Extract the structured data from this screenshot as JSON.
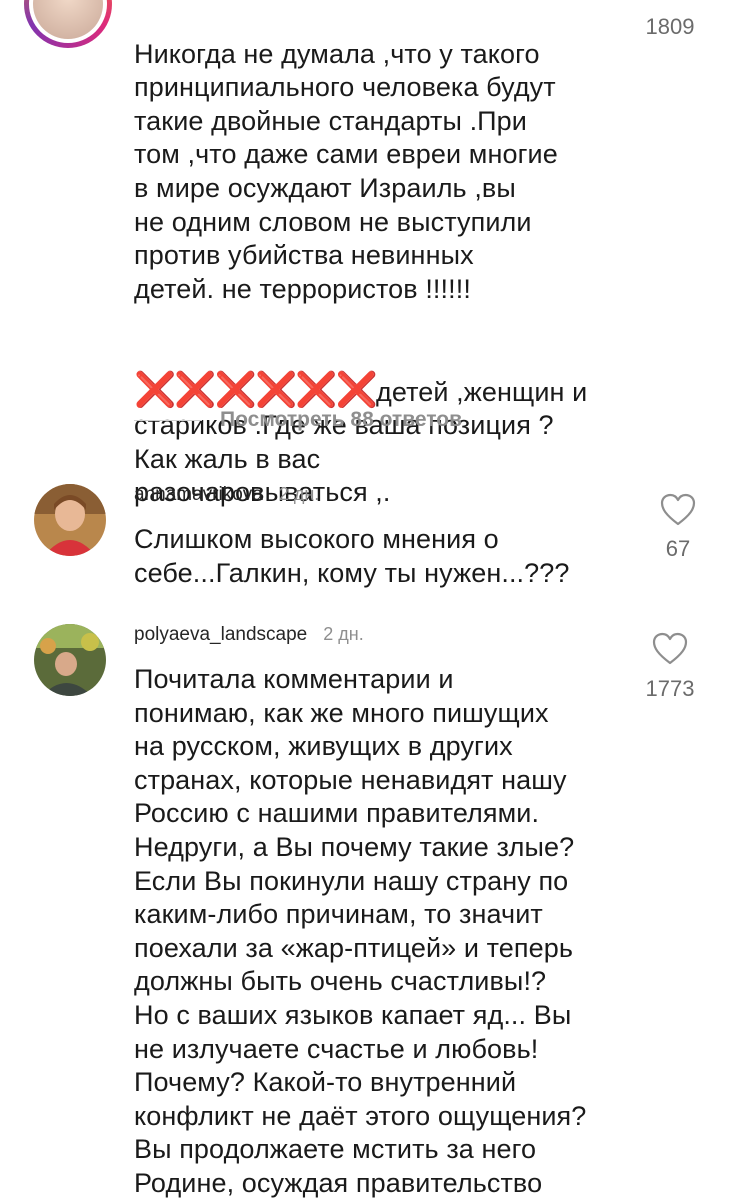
{
  "comments": [
    {
      "text_line1": "Никогда не думала ,что у такого\nпринципиального человека будут\nтакие двойные стандарты .При\nтом ,что даже сами евреи многие\nв мире осуждают Израиль ,вы\nне одним словом не выступили\nпротив убийства невинных\nдетей. не террористов !!!!!!",
      "crosses": "❌❌❌❌❌❌",
      "text_line2": "детей ,женщин и\nстариков .Где же ваша позиция ?\nКак жаль в вас\nразочаровываться ,.",
      "likes": "1809",
      "view_replies": "Посмотреть 88 ответов"
    },
    {
      "username": "annamavrikova",
      "time": "2 дн.",
      "text": "Слишком высокого мнения о\nсебе...Галкин,  кому ты нужен...???",
      "likes": "67",
      "icon": "heart-icon"
    },
    {
      "username": "polyaeva_landscape",
      "time": "2 дн.",
      "text": "Почитала комментарии и\nпонимаю, как же много пишущих\nна русском, живущих в других\nстранах, которые ненавидят  нашу\nРоссию  с нашими правителями.\nНедруги, а Вы почему такие злые?\nЕсли Вы покинули нашу страну по\nкаким-либо причинам, то  значит\nпоехали за «жар-птицей» и теперь\nдолжны быть очень счастливы!?\nНо с ваших языков капает яд... Вы\nне излучаете счастье и любовь!\nПочему? Какой-то внутренний\nконфликт не даёт этого ощущения?\nВы продолжаете мстить за него\nРодине, осуждая правительство",
      "likes": "1773",
      "icon": "heart-icon"
    }
  ],
  "colors": {
    "text": "#1a1a1a",
    "muted": "#8e8e8e",
    "cross": "#e0262f"
  }
}
